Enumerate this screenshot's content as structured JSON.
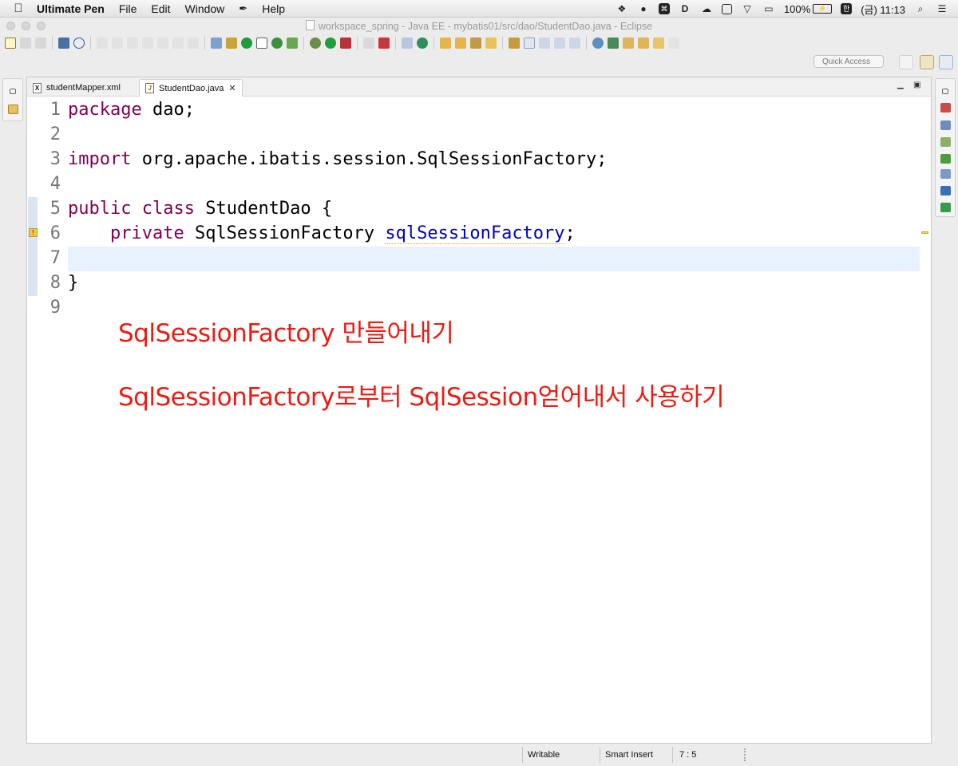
{
  "menubar": {
    "app_name": "Ultimate Pen",
    "menus": [
      "File",
      "Edit",
      "Window",
      "Help"
    ],
    "status": {
      "battery": "100%",
      "ime": "한",
      "clock": "(금) 11:13",
      "icons": [
        "dropbox-icon",
        "chat-icon",
        "keyboard-shortcut-icon",
        "d-icon",
        "cloud-icon",
        "window-icon",
        "wifi-icon",
        "airplay-icon",
        "battery-icon",
        "ime-icon",
        "spotlight-icon",
        "notification-center-icon"
      ]
    }
  },
  "window": {
    "title": "workspace_spring - Java EE - mybatis01/src/dao/StudentDao.java - Eclipse"
  },
  "toolbar": {
    "quick_access_placeholder": "Quick Access"
  },
  "editor": {
    "tabs": [
      {
        "label": "studentMapper.xml",
        "icon": "xml-file-icon",
        "active": false
      },
      {
        "label": "StudentDao.java",
        "icon": "java-file-icon",
        "active": true
      }
    ],
    "lines": [
      {
        "n": "1",
        "parts": [
          [
            "kw",
            "package"
          ],
          [
            "",
            " dao;"
          ]
        ]
      },
      {
        "n": "2",
        "parts": []
      },
      {
        "n": "3",
        "parts": [
          [
            "kw",
            "import"
          ],
          [
            "",
            " org.apache.ibatis.session.SqlSessionFactory;"
          ]
        ]
      },
      {
        "n": "4",
        "parts": []
      },
      {
        "n": "5",
        "parts": [
          [
            "kw",
            "public"
          ],
          [
            "",
            " "
          ],
          [
            "kw",
            "class"
          ],
          [
            "",
            " StudentDao {"
          ]
        ]
      },
      {
        "n": "6",
        "parts": [
          [
            "",
            "    "
          ],
          [
            "kw",
            "private"
          ],
          [
            "",
            " SqlSessionFactory "
          ],
          [
            "field",
            "sqlSessionFactory"
          ],
          [
            "",
            ";"
          ]
        ]
      },
      {
        "n": "7",
        "parts": []
      },
      {
        "n": "8",
        "parts": [
          [
            "",
            "}"
          ]
        ]
      },
      {
        "n": "9",
        "parts": []
      }
    ]
  },
  "annotations": {
    "line1": "SqlSessionFactory 만들어내기",
    "line2": "SqlSessionFactory로부터 SqlSession얻어내서 사용하기",
    "color": "#ee1b13"
  },
  "statusbar": {
    "writable": "Writable",
    "insert_mode": "Smart Insert",
    "cursor": "7 : 5"
  },
  "colors": {
    "keyword": "#7f0055",
    "field": "#0000c0",
    "current_line": "#e8f2fe"
  }
}
